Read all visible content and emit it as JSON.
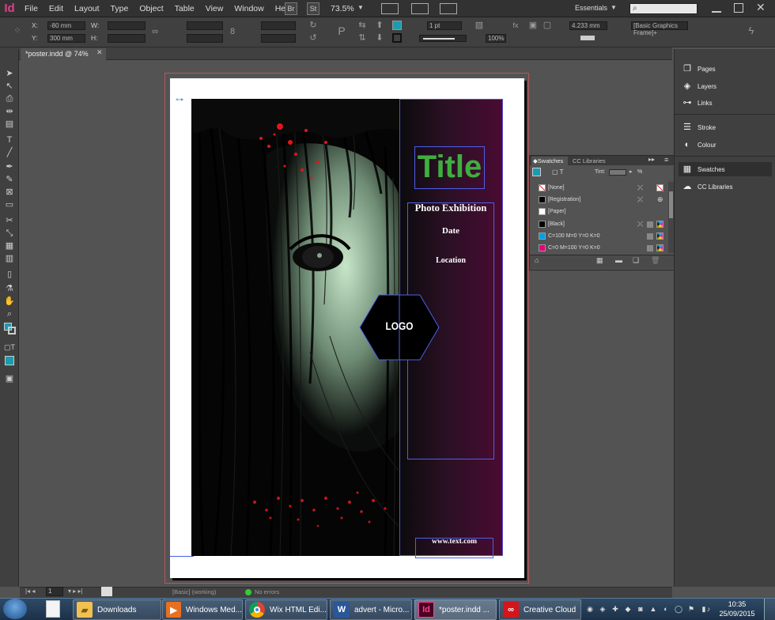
{
  "app": {
    "logo": "Id",
    "menus": [
      "File",
      "Edit",
      "Layout",
      "Type",
      "Object",
      "Table",
      "View",
      "Window",
      "Help"
    ],
    "bridge_label": "Br",
    "stock_label": "St",
    "zoom": "73.5%",
    "workspace": "Essentials",
    "search_placeholder": ""
  },
  "control": {
    "x_label": "X:",
    "x_value": "-80 mm",
    "y_label": "Y:",
    "y_value": "300 mm",
    "w_label": "W:",
    "h_label": "H:",
    "stroke_weight": "1 pt",
    "scale_percent": "100%",
    "offset_value": "4.233 mm",
    "object_style": "[Basic Graphics Frame]+"
  },
  "document": {
    "tab_title": "*poster.indd @ 74%"
  },
  "poster": {
    "title": "Title",
    "subtitle": "Photo Exhibition",
    "date": "Date",
    "location": "Location",
    "logo": "LOGO",
    "website": "www.text.com",
    "colors": {
      "title_green": "#3fae3f",
      "panel_purple": "#4a0b33",
      "frame_blue": "#4e5fe8",
      "bleed_red": "#b8575c"
    }
  },
  "dock": {
    "items": [
      "Pages",
      "Layers",
      "Links",
      "Stroke",
      "Colour",
      "Swatches",
      "CC Libraries"
    ],
    "icons": [
      "pages-icon",
      "layers-icon",
      "links-icon",
      "stroke-icon",
      "colour-icon",
      "swatches-icon",
      "cc-libraries-icon"
    ]
  },
  "swatches_panel": {
    "tabs": [
      "Swatches",
      "CC Libraries"
    ],
    "tint_label": "Tint:",
    "tint_unit": "%",
    "rows": [
      {
        "name": "[None]",
        "color": "none"
      },
      {
        "name": "[Registration]",
        "color": "#000000"
      },
      {
        "name": "[Paper]",
        "color": "#ffffff"
      },
      {
        "name": "[Black]",
        "color": "#000000"
      },
      {
        "name": "C=100 M=0 Y=0 K=0",
        "color": "#00a0e3"
      },
      {
        "name": "C=0 M=100 Y=0 K=0",
        "color": "#e5007e"
      }
    ]
  },
  "status": {
    "page_number": "1",
    "preflight_profile": "[Basic] (working)",
    "errors": "No errors"
  },
  "taskbar": {
    "items": [
      {
        "label": "Downloads",
        "icon": "folder-icon"
      },
      {
        "label": "Windows Med...",
        "icon": "media-player-icon"
      },
      {
        "label": "Wix HTML Edi...",
        "icon": "chrome-icon"
      },
      {
        "label": "advert - Micro...",
        "icon": "word-icon"
      },
      {
        "label": "*poster.indd ...",
        "icon": "indesign-icon"
      },
      {
        "label": "Creative Cloud",
        "icon": "creative-cloud-icon"
      }
    ],
    "time": "10:35",
    "date": "25/09/2015"
  }
}
